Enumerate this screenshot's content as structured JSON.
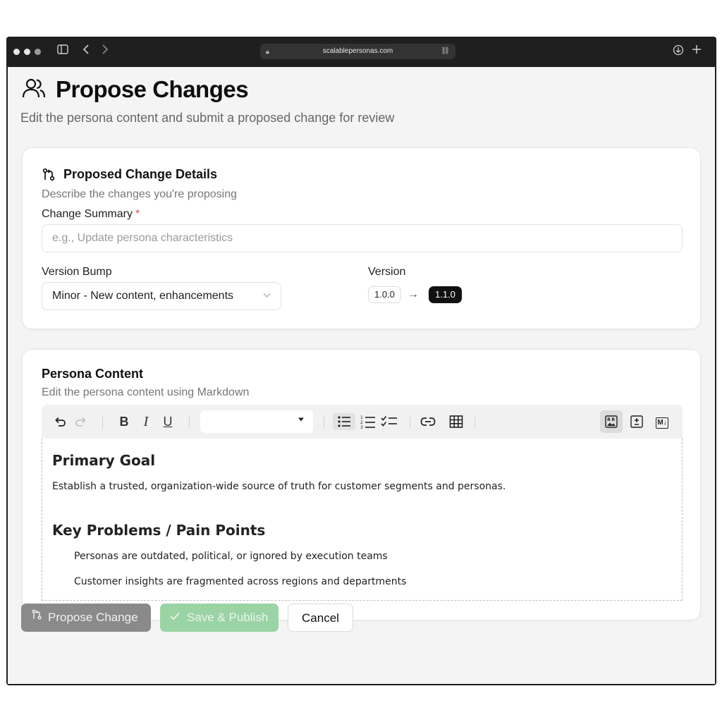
{
  "browser": {
    "url": "scalablepersonas.com"
  },
  "page": {
    "title": "Propose Changes",
    "subtitle": "Edit the persona content and submit a proposed change for review"
  },
  "details_card": {
    "title": "Proposed Change Details",
    "description": "Describe the changes you're proposing",
    "summary_label": "Change Summary",
    "required_mark": "*",
    "summary_placeholder": "e.g., Update persona characteristics",
    "version_bump_label": "Version Bump",
    "version_bump_value": "Minor - New content, enhancements",
    "version_label": "Version",
    "version_from": "1.0.0",
    "version_arrow": "→",
    "version_to": "1.1.0"
  },
  "content_card": {
    "title": "Persona Content",
    "description": "Edit the persona content using Markdown",
    "toolbar": {
      "bold": "B",
      "italic": "I",
      "underline": "U",
      "mode_markdown": "M↓"
    },
    "editor": {
      "heading1": "Primary Goal",
      "paragraph1": "Establish a trusted, organization-wide source of truth for customer segments and personas.",
      "heading2": "Key Problems / Pain Points",
      "list_items": [
        "Personas are outdated, political, or ignored by execution teams",
        "Customer insights are fragmented across regions and departments"
      ]
    }
  },
  "actions": {
    "propose": "Propose Change",
    "publish": "Save & Publish",
    "cancel": "Cancel"
  },
  "colors": {
    "publish_button": "#9ad3a4",
    "propose_button": "#8a8a8a",
    "required": "#e05252"
  }
}
